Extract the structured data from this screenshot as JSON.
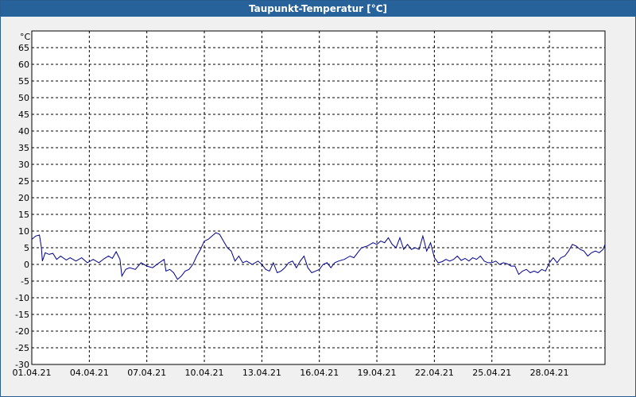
{
  "window": {
    "title": "Taupunkt-Temperatur [°C]"
  },
  "chart_data": {
    "type": "line",
    "title": "Taupunkt-Temperatur [°C]",
    "xlabel": "",
    "ylabel": "",
    "y_unit_label": "°C",
    "ylim": [
      -30,
      65
    ],
    "yticks": [
      65,
      60,
      55,
      50,
      45,
      40,
      35,
      30,
      25,
      20,
      15,
      10,
      5,
      0,
      -5,
      -10,
      -15,
      -20,
      -25,
      -30
    ],
    "xlim_days": [
      1,
      30.9
    ],
    "xticks": [
      {
        "label": "01.04.21",
        "day": 1
      },
      {
        "label": "04.04.21",
        "day": 4
      },
      {
        "label": "07.04.21",
        "day": 7
      },
      {
        "label": "10.04.21",
        "day": 10
      },
      {
        "label": "13.04.21",
        "day": 13
      },
      {
        "label": "16.04.21",
        "day": 16
      },
      {
        "label": "19.04.21",
        "day": 19
      },
      {
        "label": "22.04.21",
        "day": 22
      },
      {
        "label": "25.04.21",
        "day": 25
      },
      {
        "label": "28.04.21",
        "day": 28
      }
    ],
    "grid": true,
    "colors": {
      "line": "#00008b",
      "grid": "#000000",
      "plot_bg": "#ffffff",
      "titlebar": "#27639a"
    },
    "series": [
      {
        "values": [
          [
            1.0,
            7.5
          ],
          [
            1.2,
            8.5
          ],
          [
            1.4,
            8.8
          ],
          [
            1.5,
            5.0
          ],
          [
            1.55,
            1.0
          ],
          [
            1.7,
            3.5
          ],
          [
            1.9,
            3.0
          ],
          [
            2.1,
            3.3
          ],
          [
            2.3,
            1.5
          ],
          [
            2.5,
            2.5
          ],
          [
            2.8,
            1.3
          ],
          [
            3.0,
            2.0
          ],
          [
            3.3,
            1.0
          ],
          [
            3.6,
            2.0
          ],
          [
            3.9,
            0.5
          ],
          [
            4.2,
            1.5
          ],
          [
            4.5,
            0.5
          ],
          [
            4.8,
            1.8
          ],
          [
            5.0,
            2.5
          ],
          [
            5.2,
            1.8
          ],
          [
            5.4,
            3.8
          ],
          [
            5.6,
            1.5
          ],
          [
            5.7,
            -3.5
          ],
          [
            5.9,
            -1.5
          ],
          [
            6.1,
            -1.0
          ],
          [
            6.4,
            -1.5
          ],
          [
            6.7,
            0.5
          ],
          [
            7.0,
            -0.5
          ],
          [
            7.3,
            -1.0
          ],
          [
            7.6,
            0.3
          ],
          [
            7.9,
            1.5
          ],
          [
            8.0,
            -2.0
          ],
          [
            8.2,
            -1.5
          ],
          [
            8.4,
            -2.5
          ],
          [
            8.6,
            -4.5
          ],
          [
            8.8,
            -3.5
          ],
          [
            9.0,
            -2.0
          ],
          [
            9.2,
            -1.5
          ],
          [
            9.4,
            0.0
          ],
          [
            9.6,
            2.5
          ],
          [
            9.8,
            4.5
          ],
          [
            10.0,
            7.0
          ],
          [
            10.2,
            7.5
          ],
          [
            10.4,
            8.5
          ],
          [
            10.6,
            9.5
          ],
          [
            10.8,
            9.0
          ],
          [
            11.0,
            7.0
          ],
          [
            11.2,
            5.0
          ],
          [
            11.4,
            4.0
          ],
          [
            11.6,
            1.0
          ],
          [
            11.8,
            2.5
          ],
          [
            12.0,
            0.5
          ],
          [
            12.2,
            1.0
          ],
          [
            12.5,
            0.0
          ],
          [
            12.8,
            1.0
          ],
          [
            13.0,
            0.0
          ],
          [
            13.2,
            -1.5
          ],
          [
            13.4,
            -2.0
          ],
          [
            13.6,
            0.5
          ],
          [
            13.8,
            -2.5
          ],
          [
            14.0,
            -2.0
          ],
          [
            14.2,
            -1.0
          ],
          [
            14.4,
            0.5
          ],
          [
            14.6,
            1.0
          ],
          [
            14.8,
            -1.0
          ],
          [
            15.0,
            1.0
          ],
          [
            15.2,
            2.5
          ],
          [
            15.4,
            -1.0
          ],
          [
            15.6,
            -2.5
          ],
          [
            15.8,
            -2.0
          ],
          [
            16.0,
            -1.5
          ],
          [
            16.2,
            0.0
          ],
          [
            16.4,
            0.5
          ],
          [
            16.6,
            -1.0
          ],
          [
            16.8,
            0.5
          ],
          [
            17.0,
            1.0
          ],
          [
            17.3,
            1.5
          ],
          [
            17.6,
            2.5
          ],
          [
            17.8,
            2.0
          ],
          [
            18.0,
            3.5
          ],
          [
            18.2,
            5.0
          ],
          [
            18.5,
            5.5
          ],
          [
            18.8,
            6.5
          ],
          [
            19.0,
            6.0
          ],
          [
            19.2,
            7.0
          ],
          [
            19.4,
            6.5
          ],
          [
            19.6,
            8.0
          ],
          [
            19.8,
            6.0
          ],
          [
            20.0,
            5.0
          ],
          [
            20.2,
            8.0
          ],
          [
            20.4,
            4.5
          ],
          [
            20.6,
            6.0
          ],
          [
            20.8,
            4.5
          ],
          [
            21.0,
            5.0
          ],
          [
            21.2,
            4.5
          ],
          [
            21.4,
            8.5
          ],
          [
            21.6,
            4.0
          ],
          [
            21.8,
            6.5
          ],
          [
            22.0,
            2.0
          ],
          [
            22.2,
            0.5
          ],
          [
            22.4,
            0.8
          ],
          [
            22.6,
            1.5
          ],
          [
            22.8,
            1.0
          ],
          [
            23.0,
            1.5
          ],
          [
            23.2,
            2.5
          ],
          [
            23.4,
            1.2
          ],
          [
            23.6,
            1.8
          ],
          [
            23.8,
            1.0
          ],
          [
            24.0,
            2.0
          ],
          [
            24.2,
            1.5
          ],
          [
            24.4,
            2.5
          ],
          [
            24.6,
            1.0
          ],
          [
            24.8,
            0.5
          ],
          [
            25.0,
            0.5
          ],
          [
            25.2,
            1.0
          ],
          [
            25.4,
            0.0
          ],
          [
            25.6,
            0.5
          ],
          [
            25.8,
            0.2
          ],
          [
            26.0,
            -0.5
          ],
          [
            26.2,
            -0.5
          ],
          [
            26.4,
            -3.0
          ],
          [
            26.6,
            -2.0
          ],
          [
            26.8,
            -1.5
          ],
          [
            27.0,
            -2.5
          ],
          [
            27.2,
            -2.0
          ],
          [
            27.4,
            -2.5
          ],
          [
            27.6,
            -1.5
          ],
          [
            27.8,
            -2.0
          ],
          [
            28.0,
            0.5
          ],
          [
            28.2,
            2.0
          ],
          [
            28.4,
            0.5
          ],
          [
            28.6,
            2.0
          ],
          [
            28.8,
            2.5
          ],
          [
            29.0,
            4.0
          ],
          [
            29.2,
            6.0
          ],
          [
            29.4,
            5.5
          ],
          [
            29.6,
            4.5
          ],
          [
            29.8,
            4.0
          ],
          [
            30.0,
            2.5
          ],
          [
            30.2,
            3.5
          ],
          [
            30.4,
            4.0
          ],
          [
            30.6,
            3.5
          ],
          [
            30.8,
            4.5
          ],
          [
            30.9,
            6.0
          ]
        ]
      }
    ]
  }
}
